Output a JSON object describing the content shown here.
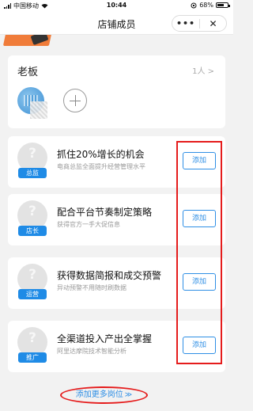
{
  "status_bar": {
    "carrier": "中国移动",
    "wifi_icon": "wifi-icon",
    "time": "10:44",
    "battery_percent": "68%",
    "battery_level": 0.68
  },
  "nav": {
    "title": "店铺成员",
    "more_icon": "•••",
    "close_icon": "✕"
  },
  "boss": {
    "title": "老板",
    "count": "1人 >"
  },
  "roles": [
    {
      "badge": "总监",
      "title": "抓住20%增长的机会",
      "desc": "电商总监全面提升经营管理水平",
      "button": "添加"
    },
    {
      "badge": "店长",
      "title": "配合平台节奏制定策略",
      "desc": "获得官方一手大促信息",
      "button": "添加"
    },
    {
      "badge": "运营",
      "title": "获得数据简报和成交预警",
      "desc": "异动预警不用随时刷数据",
      "button": "添加"
    },
    {
      "badge": "推广",
      "title": "全渠道投入产出全掌握",
      "desc": "阿里达摩院技术智能分析",
      "button": "添加"
    }
  ],
  "footer": {
    "more_roles": "添加更多岗位",
    "chevron": "≫"
  },
  "colors": {
    "accent": "#2f8fe5",
    "badge": "#1f8be6",
    "highlight": "#e51c1c"
  }
}
